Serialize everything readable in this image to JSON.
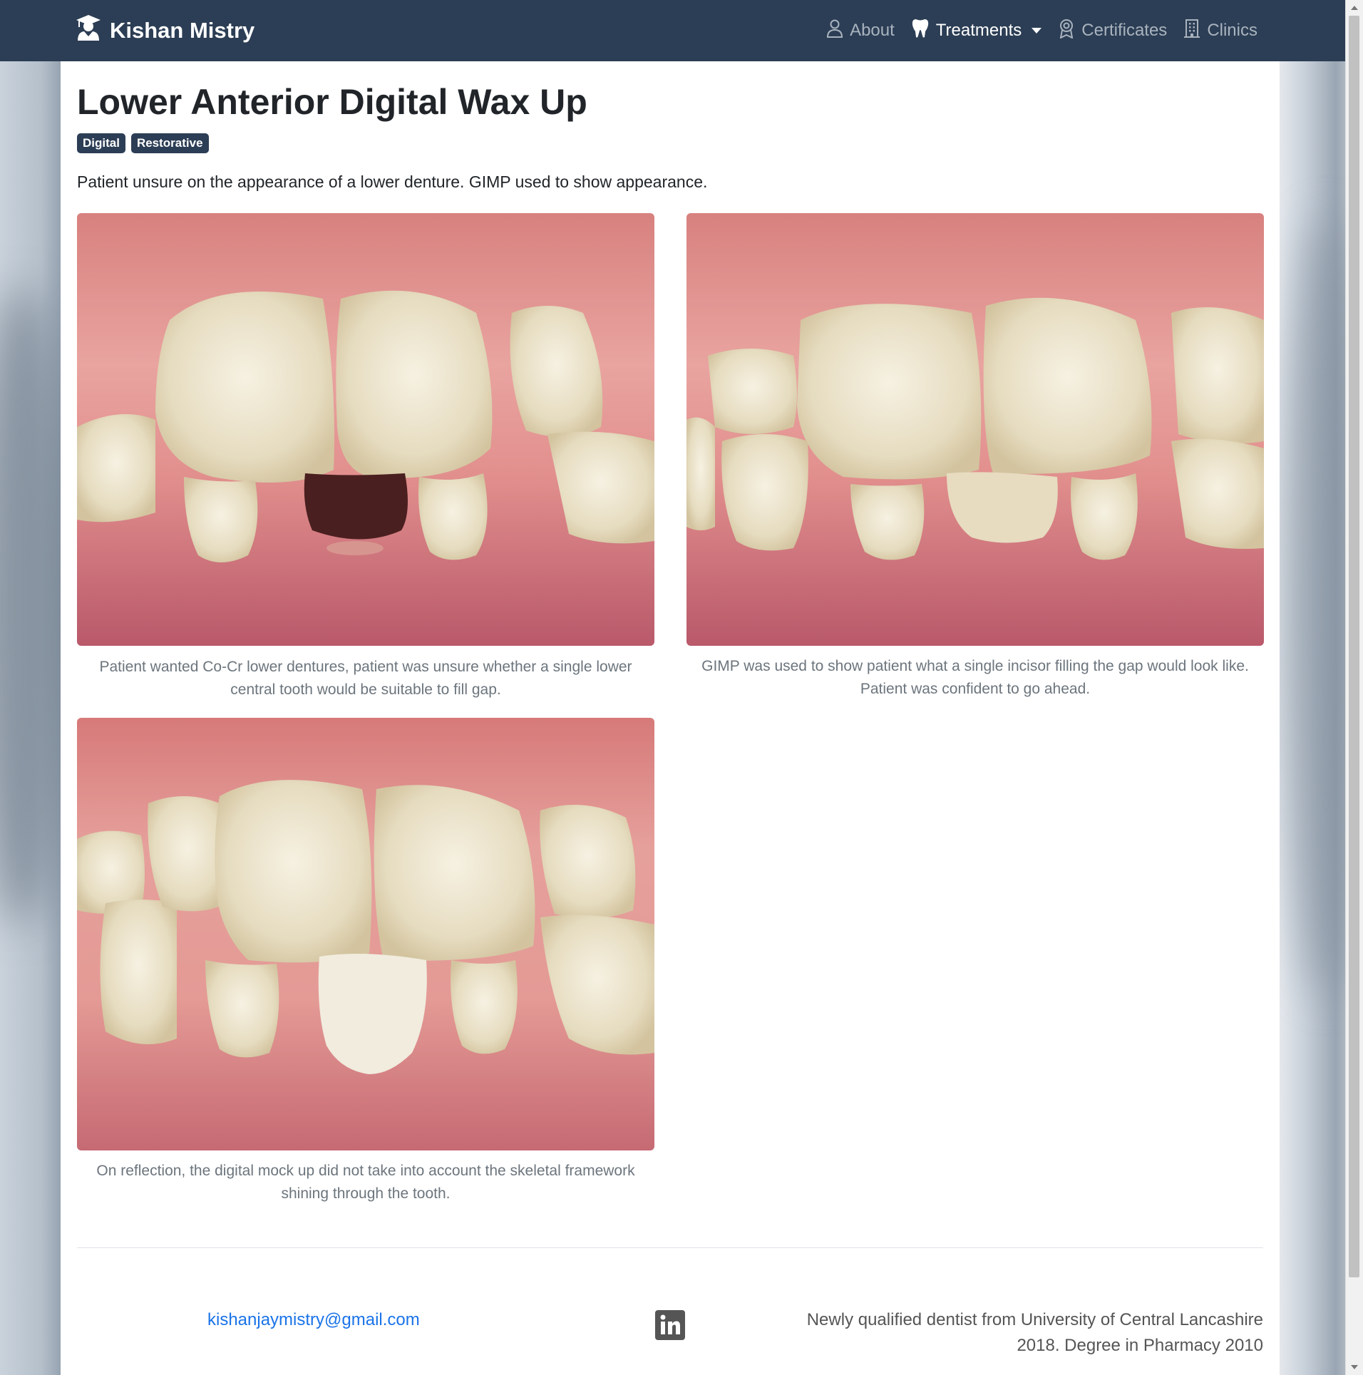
{
  "navbar": {
    "brand": "Kishan Mistry",
    "links": [
      {
        "label": "About",
        "icon": "person-icon"
      },
      {
        "label": "Treatments",
        "icon": "tooth-icon",
        "active": true
      },
      {
        "label": "Certificates",
        "icon": "award-icon"
      },
      {
        "label": "Clinics",
        "icon": "building-icon"
      }
    ]
  },
  "page": {
    "title": "Lower Anterior Digital Wax Up",
    "tags": [
      "Digital",
      "Restorative"
    ],
    "intro": "Patient unsure on the appearance of a lower denture. GIMP used to show appearance."
  },
  "gallery": [
    {
      "caption": "Patient wanted Co-Cr lower dentures, patient was unsure whether a single lower central tooth would be suitable to fill gap."
    },
    {
      "caption": "GIMP was used to show patient what a single incisor filling the gap would look like. Patient was confident to go ahead."
    },
    {
      "caption": "On reflection, the digital mock up did not take into account the skeletal framework shining through the tooth."
    }
  ],
  "footer": {
    "email": "kishanjaymistry@gmail.com",
    "bio": "Newly qualified dentist from University of Central Lancashire 2018. Degree in Pharmacy 2010"
  },
  "colors": {
    "navbar": "#2c3e55",
    "link": "#1a73e8",
    "badge": "#2c3e55"
  }
}
